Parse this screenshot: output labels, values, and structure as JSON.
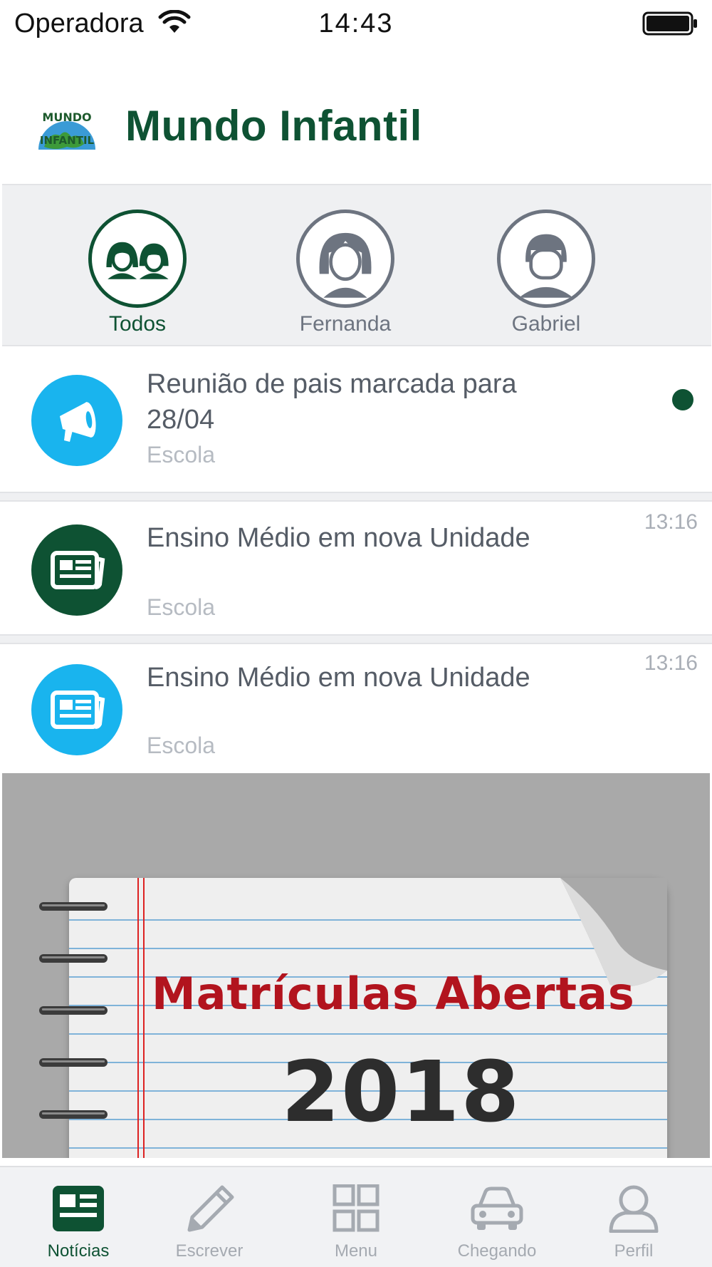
{
  "status_bar": {
    "carrier": "Operadora",
    "time": "14:43"
  },
  "header": {
    "title": "Mundo Infantil",
    "logo_text": "MUNDO INFANTIL"
  },
  "children": [
    {
      "name": "Todos",
      "icon": "two-kids-icon",
      "active": true
    },
    {
      "name": "Fernanda",
      "icon": "girl-avatar-icon",
      "active": false
    },
    {
      "name": "Gabriel",
      "icon": "boy-avatar-icon",
      "active": false
    }
  ],
  "news": [
    {
      "title": "Reunião de pais marcada para 28/04",
      "source": "Escola",
      "time": "",
      "unread": true,
      "icon": "megaphone-icon",
      "icon_color": "#19b4ee"
    },
    {
      "title": "Ensino Médio em nova Unidade",
      "source": "Escola",
      "time": "13:16",
      "unread": false,
      "icon": "newspaper-icon",
      "icon_color": "#0e5233"
    },
    {
      "title": "Ensino Médio em nova Unidade",
      "source": "Escola",
      "time": "13:16",
      "unread": false,
      "icon": "newspaper-icon",
      "icon_color": "#19b4ee"
    }
  ],
  "banner": {
    "title": "Matrículas Abertas",
    "year": "2018"
  },
  "tabs": [
    {
      "label": "Notícias",
      "icon": "news-icon",
      "active": true
    },
    {
      "label": "Escrever",
      "icon": "pencil-icon",
      "active": false
    },
    {
      "label": "Menu",
      "icon": "grid-icon",
      "active": false
    },
    {
      "label": "Chegando",
      "icon": "car-icon",
      "active": false
    },
    {
      "label": "Perfil",
      "icon": "user-icon",
      "active": false
    }
  ],
  "colors": {
    "brand_green": "#0e5233",
    "accent_blue": "#19b4ee",
    "muted_gray": "#6d7480"
  }
}
